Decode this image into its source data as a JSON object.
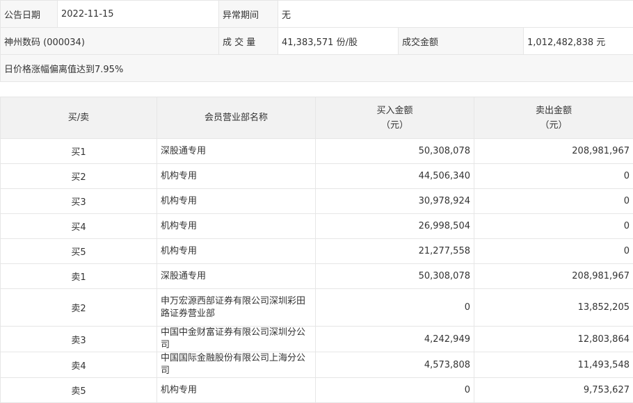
{
  "announcement": {
    "date_label": "公告日期",
    "date": "2022-11-15",
    "abnormal_period_label": "异常期间",
    "abnormal_period": "无",
    "stock": "神州数码 (000034)",
    "volume_label": "成 交 量",
    "volume": "41,383,571 份/股",
    "amount_label": "成交金额",
    "amount": "1,012,482,838 元",
    "reason": "日价格涨幅偏离值达到7.95%"
  },
  "trades": {
    "headers": {
      "side": "买/卖",
      "branch": "会员营业部名称",
      "buy_line1": "买入金额",
      "buy_line2": "（元）",
      "sell_line1": "卖出金额",
      "sell_line2": "（元）"
    },
    "rows": [
      {
        "side": "买1",
        "branch": "深股通专用",
        "buy": "50,308,078",
        "sell": "208,981,967"
      },
      {
        "side": "买2",
        "branch": "机构专用",
        "buy": "44,506,340",
        "sell": "0"
      },
      {
        "side": "买3",
        "branch": "机构专用",
        "buy": "30,978,924",
        "sell": "0"
      },
      {
        "side": "买4",
        "branch": "机构专用",
        "buy": "26,998,504",
        "sell": "0"
      },
      {
        "side": "买5",
        "branch": "机构专用",
        "buy": "21,277,558",
        "sell": "0"
      },
      {
        "side": "卖1",
        "branch": "深股通专用",
        "buy": "50,308,078",
        "sell": "208,981,967"
      },
      {
        "side": "卖2",
        "branch": "申万宏源西部证券有限公司深圳彩田路证券营业部",
        "buy": "0",
        "sell": "13,852,205"
      },
      {
        "side": "卖3",
        "branch": "中国中金财富证券有限公司深圳分公司",
        "buy": "4,242,949",
        "sell": "12,803,864"
      },
      {
        "side": "卖4",
        "branch": "中国国际金融股份有限公司上海分公司",
        "buy": "4,573,808",
        "sell": "11,493,548"
      },
      {
        "side": "卖5",
        "branch": "机构专用",
        "buy": "0",
        "sell": "9,753,627"
      }
    ]
  }
}
